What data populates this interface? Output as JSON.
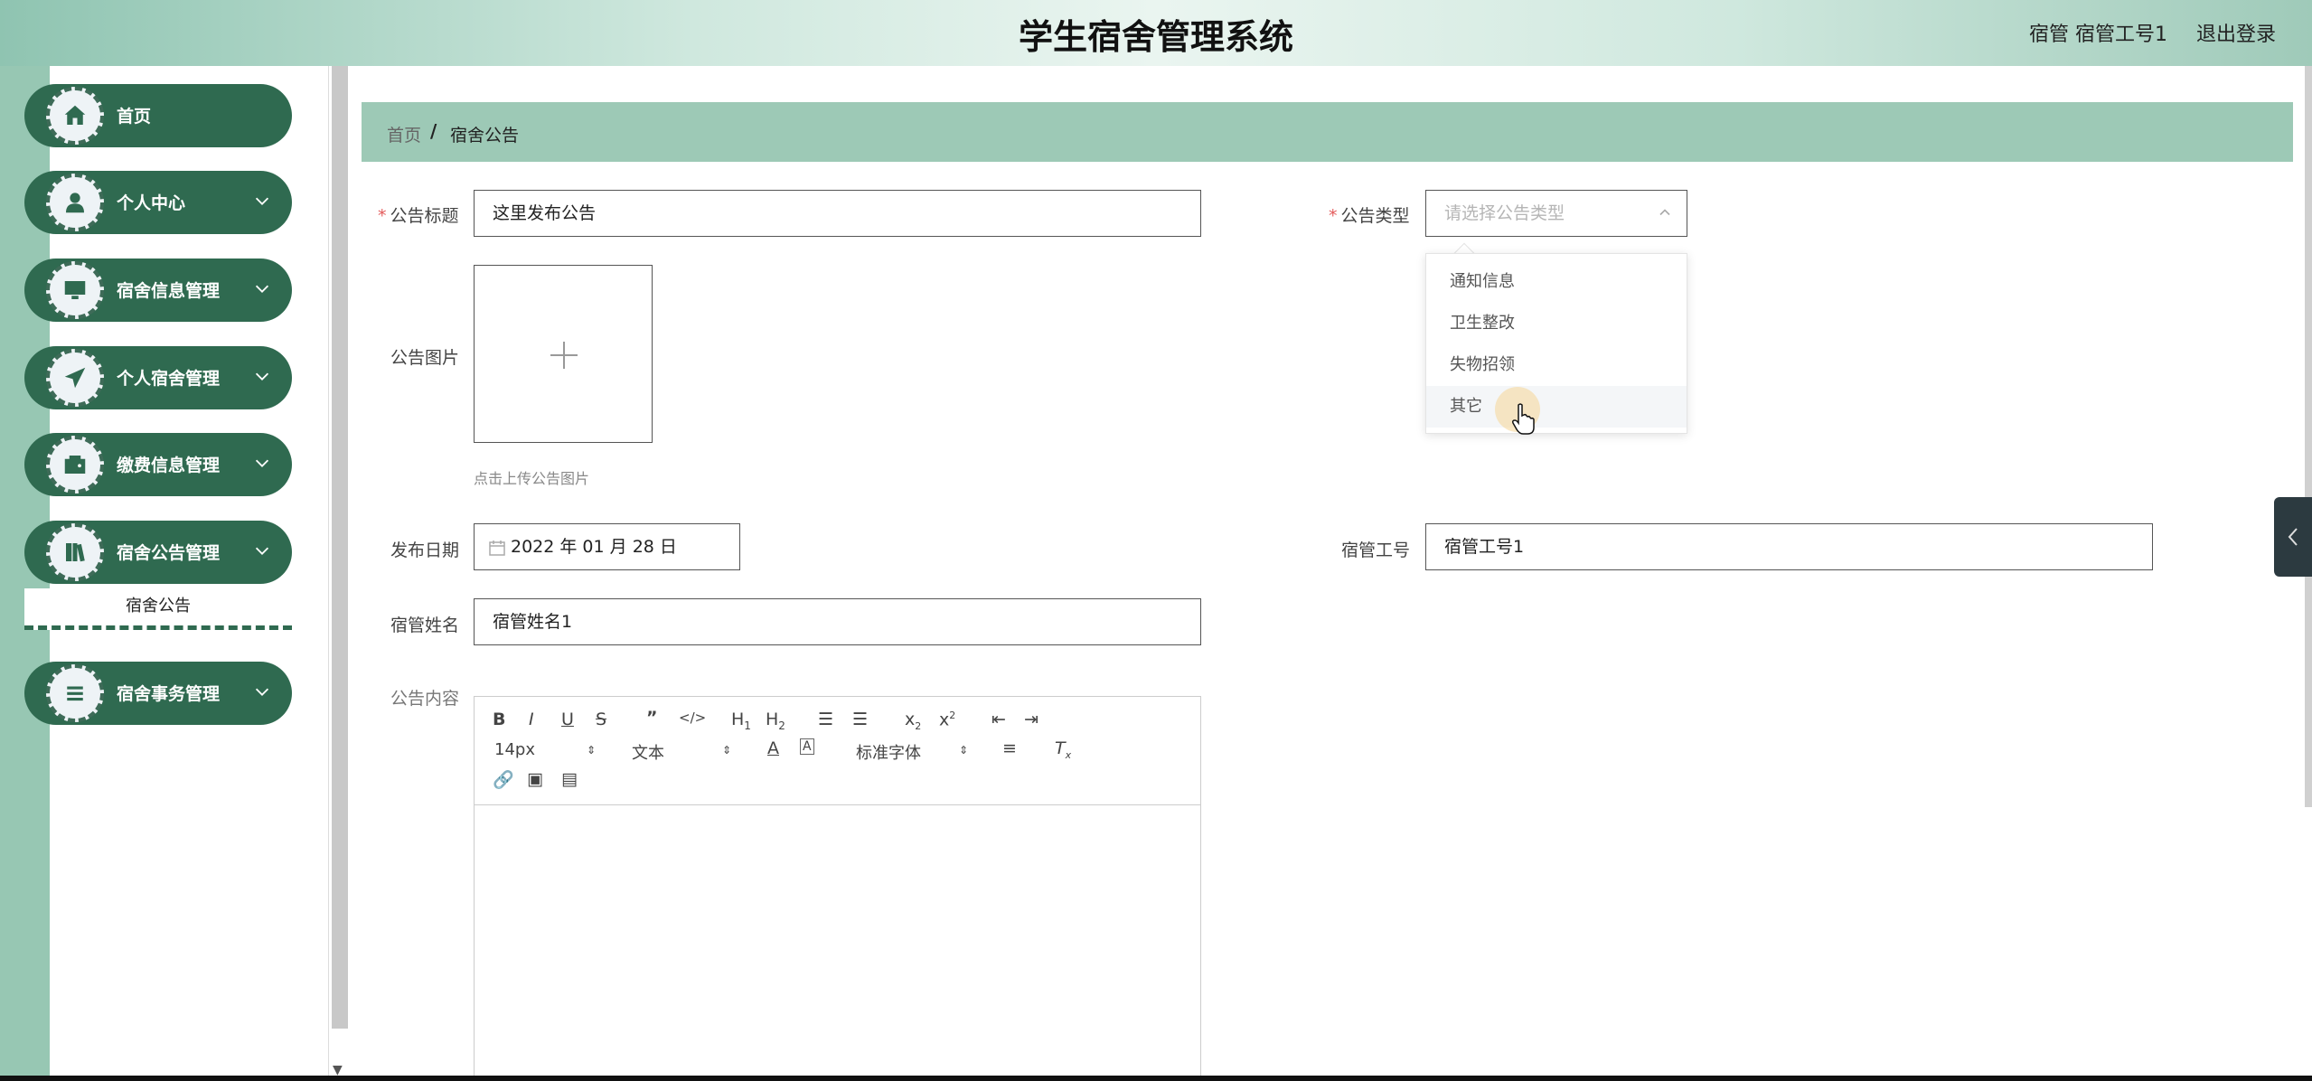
{
  "header": {
    "title": "学生宿舍管理系统",
    "user": "宿管 宿管工号1",
    "logout": "退出登录"
  },
  "sidebar": {
    "items": [
      {
        "label": "首页",
        "icon": "home-icon"
      },
      {
        "label": "个人中心",
        "icon": "user-icon"
      },
      {
        "label": "宿舍信息管理",
        "icon": "monitor-icon"
      },
      {
        "label": "个人宿舍管理",
        "icon": "send-icon"
      },
      {
        "label": "缴费信息管理",
        "icon": "wallet-icon"
      },
      {
        "label": "宿舍公告管理",
        "icon": "book-icon"
      },
      {
        "label": "宿舍事务管理",
        "icon": "list-icon"
      }
    ],
    "submenu": {
      "label": "宿舍公告"
    }
  },
  "breadcrumb": {
    "home": "首页",
    "separator": "/",
    "current": "宿舍公告"
  },
  "form": {
    "title_label": "公告标题",
    "title_value": "这里发布公告",
    "type_label": "公告类型",
    "type_placeholder": "请选择公告类型",
    "image_label": "公告图片",
    "image_hint": "点击上传公告图片",
    "date_label": "发布日期",
    "date_value": "2022 年 01 月 28 日",
    "manager_id_label": "宿管工号",
    "manager_id_value": "宿管工号1",
    "manager_name_label": "宿管姓名",
    "manager_name_value": "宿管姓名1",
    "content_label": "公告内容"
  },
  "dropdown": {
    "options": [
      "通知信息",
      "卫生整改",
      "失物招领",
      "其它"
    ],
    "hovered": "其它"
  },
  "editor": {
    "font_size": "14px",
    "paragraph": "文本",
    "font_family": "标准字体"
  },
  "colors": {
    "accent": "#2f6a50",
    "breadcrumb_bg": "#9dc9b6",
    "required": "#e35b5b"
  }
}
